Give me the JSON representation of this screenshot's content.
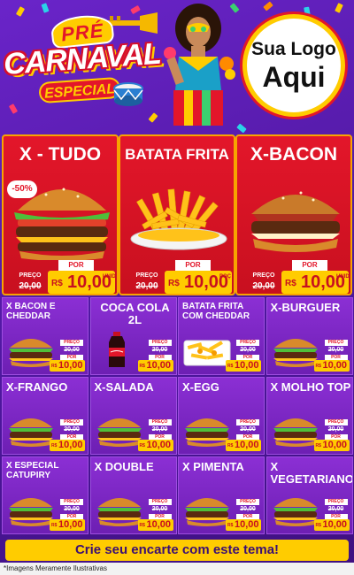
{
  "header": {
    "pre": "PRÉ",
    "carnaval": "CARNAVAL",
    "especial": "ESPECIAL",
    "logo_line1": "Sua Logo",
    "logo_line2": "Aqui"
  },
  "featured": [
    {
      "title": "X - TUDO",
      "discount": "-50%",
      "old_label": "PREÇO",
      "old_price": "20,00",
      "por": "POR",
      "currency": "R$",
      "price": "10,00",
      "unit": "UNID"
    },
    {
      "title": "BATATA FRITA",
      "old_label": "PREÇO",
      "old_price": "20,00",
      "por": "POR",
      "currency": "R$",
      "price": "10,00",
      "unit": "POÇ"
    },
    {
      "title": "X-BACON",
      "old_label": "PREÇO",
      "old_price": "20,00",
      "por": "POR",
      "currency": "R$",
      "price": "10,00",
      "unit": "UNID"
    }
  ],
  "items": [
    {
      "title": "X BACON E CHEDDAR",
      "kind": "burger",
      "old_label": "PREÇO",
      "old_price": "20,00",
      "por": "POR",
      "currency": "R$",
      "price": "10,00"
    },
    {
      "title": "COCA COLA 2L",
      "kind": "soda",
      "old_label": "PREÇO",
      "old_price": "20,00",
      "por": "POR",
      "currency": "R$",
      "price": "10,00"
    },
    {
      "title": "BATATA FRITA COM CHEDDAR",
      "kind": "fries",
      "old_label": "PREÇO",
      "old_price": "20,00",
      "por": "POR",
      "currency": "R$",
      "price": "10,00"
    },
    {
      "title": "X-BURGUER",
      "kind": "burger",
      "old_label": "PREÇO",
      "old_price": "20,00",
      "por": "POR",
      "currency": "R$",
      "price": "10,00"
    },
    {
      "title": "X-FRANGO",
      "kind": "burger",
      "old_label": "PREÇO",
      "old_price": "20,00",
      "por": "POR",
      "currency": "R$",
      "price": "10,00"
    },
    {
      "title": "X-SALADA",
      "kind": "burger",
      "old_label": "PREÇO",
      "old_price": "20,00",
      "por": "POR",
      "currency": "R$",
      "price": "10,00"
    },
    {
      "title": "X-EGG",
      "kind": "burger",
      "old_label": "PREÇO",
      "old_price": "20,00",
      "por": "POR",
      "currency": "R$",
      "price": "10,00"
    },
    {
      "title": "X MOLHO TOP",
      "kind": "burger",
      "old_label": "PREÇO",
      "old_price": "20,00",
      "por": "POR",
      "currency": "R$",
      "price": "10,00"
    },
    {
      "title": "X ESPECIAL CATUPIRY",
      "kind": "burger",
      "old_label": "PREÇO",
      "old_price": "20,00",
      "por": "POR",
      "currency": "R$",
      "price": "10,00"
    },
    {
      "title": "X DOUBLE",
      "kind": "burger",
      "old_label": "PREÇO",
      "old_price": "20,00",
      "por": "POR",
      "currency": "R$",
      "price": "10,00"
    },
    {
      "title": "X PIMENTA",
      "kind": "burger",
      "old_label": "PREÇO",
      "old_price": "20,00",
      "por": "POR",
      "currency": "R$",
      "price": "10,00"
    },
    {
      "title": "X VEGETARIANO",
      "kind": "burger",
      "old_label": "PREÇO",
      "old_price": "20,00",
      "por": "POR",
      "currency": "R$",
      "price": "10,00"
    }
  ],
  "cta": "Crie seu encarte com este tema!",
  "footer": "*Imagens Meramente Ilustrativas",
  "colors": {
    "red": "#e3162a",
    "yellow": "#ffcc00",
    "purple": "#6d1fb3"
  }
}
